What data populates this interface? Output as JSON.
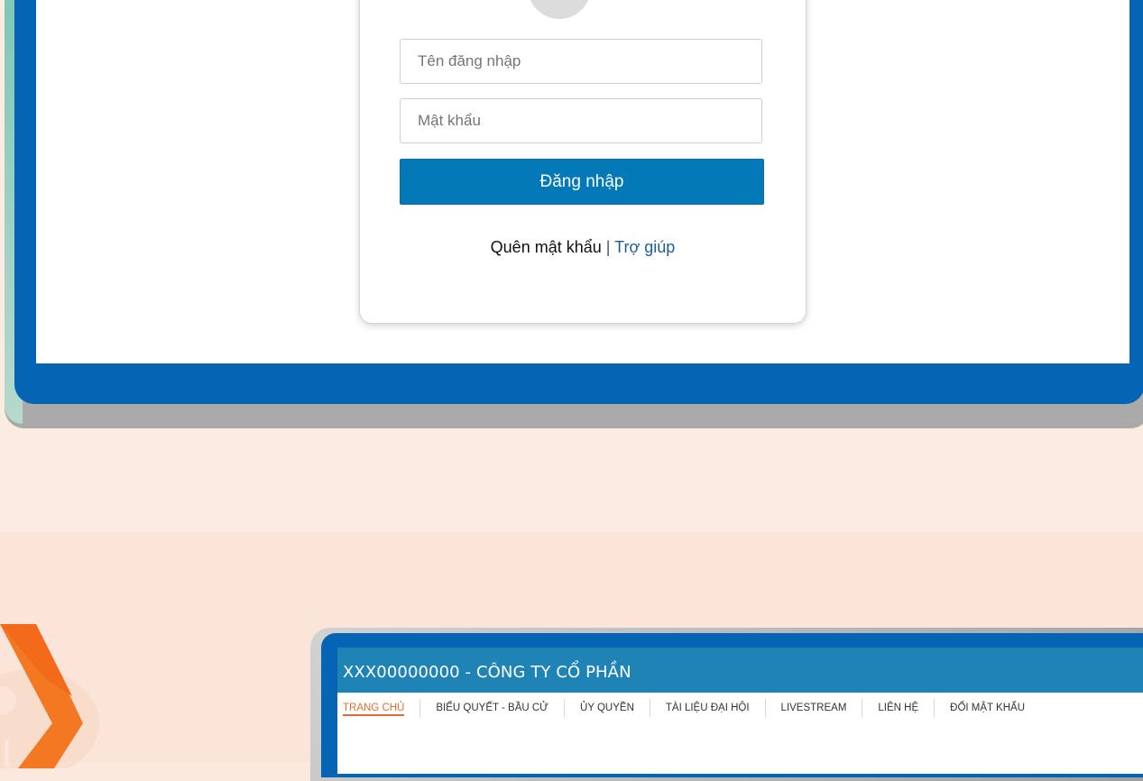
{
  "login": {
    "username_placeholder": "Tên đăng nhập",
    "password_placeholder": "Mật khẩu",
    "login_button": "Đăng nhập",
    "forgot_password": "Quên mật khẩu",
    "separator": "|",
    "help": "Trợ giúp"
  },
  "app": {
    "title": "XXX00000000 - CÔNG TY CỔ PHẦN",
    "nav": [
      {
        "label": "TRANG CHỦ",
        "active": true
      },
      {
        "label": "BIỂU QUYẾT - BẦU CỬ"
      },
      {
        "label": "ỦY QUYỀN"
      },
      {
        "label": "TÀI LIỆU ĐẠI HỘI"
      },
      {
        "label": "LIVESTREAM"
      },
      {
        "label": "LIÊN HỆ"
      },
      {
        "label": "ĐỔI MẬT KHẨU"
      }
    ]
  },
  "colors": {
    "background": "#fce9de",
    "frame_blue": "#0565b4",
    "button_blue": "#0479b8",
    "header_blue": "#1f83b6",
    "nav_active": "#e46c2a",
    "orange_accent": "#f47721"
  },
  "icons": {
    "avatar": "user-avatar-icon",
    "decoration": "orange-chevron-decoration"
  }
}
